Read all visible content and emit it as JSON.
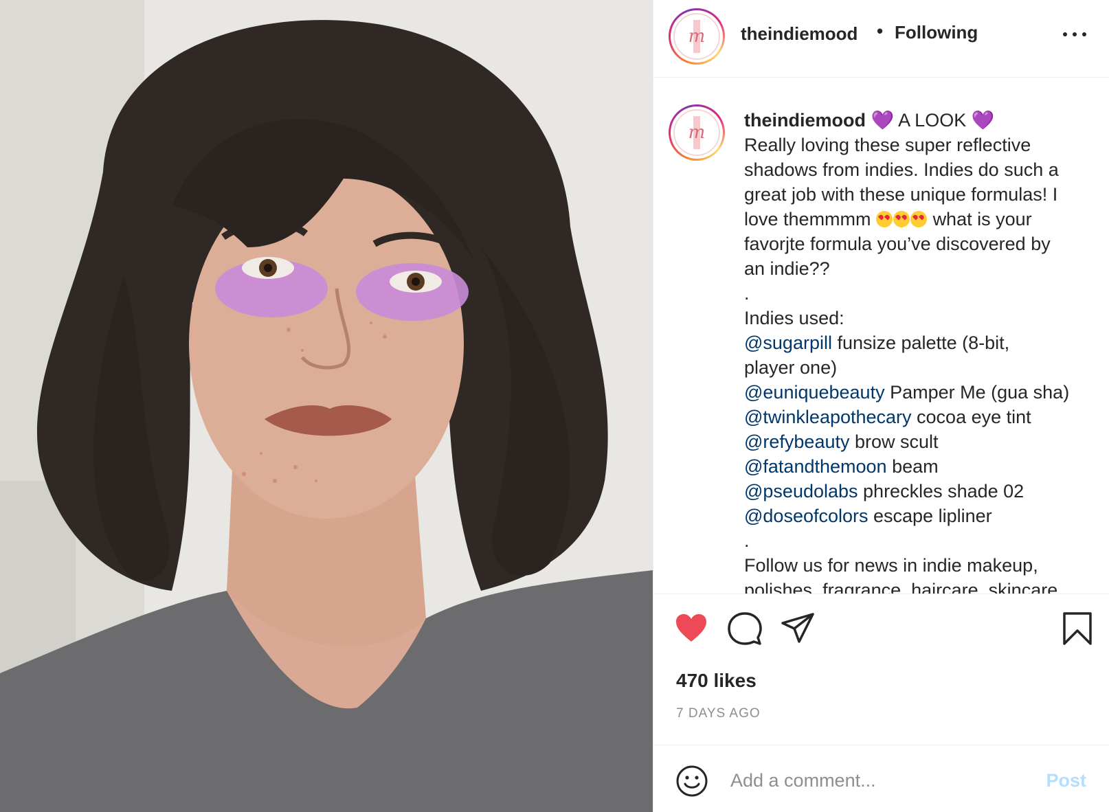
{
  "post": {
    "username": "theindiemood",
    "separator": "•",
    "follow_status": "Following",
    "more_icon": "more-horizontal-icon"
  },
  "caption": {
    "username": "theindiemood",
    "title": "A LOOK",
    "heart_emoji": "💜",
    "lines": [
      "Really loving these super reflective",
      "shadows from indies. Indies do such a",
      "great job with these unique formulas! I"
    ],
    "love_prefix": "love themmmm",
    "love_suffix": "what is your",
    "lines2": [
      "favorjte formula you’ve discovered by",
      "an indie??",
      ".",
      "Indies used:"
    ],
    "products": [
      {
        "mention": "@sugarpill",
        "text": " funsize palette (8-bit,"
      },
      {
        "mention": "",
        "text": "player one)"
      },
      {
        "mention": "@euniquebeauty",
        "text": " Pamper Me (gua sha)"
      },
      {
        "mention": "@twinkleapothecary",
        "text": " cocoa eye tint"
      },
      {
        "mention": "@refybeauty",
        "text": " brow scult"
      },
      {
        "mention": "@fatandthemoon",
        "text": " beam"
      },
      {
        "mention": "@pseudolabs",
        "text": " phreckles shade 02"
      },
      {
        "mention": "@doseofcolors",
        "text": " escape lipliner"
      }
    ],
    "after": [
      ".",
      "Follow us for news in indie makeup,",
      "polishes, fragrance, haircare, skincare"
    ]
  },
  "actions": {
    "like_icon": "heart-filled-icon",
    "comment_icon": "comment-icon",
    "share_icon": "share-icon",
    "save_icon": "bookmark-icon",
    "like_color": "#ed4956"
  },
  "likes": "470 likes",
  "time_ago": "7 DAYS AGO",
  "comment": {
    "placeholder": "Add a comment...",
    "post_label": "Post",
    "emoji_icon": "smiley-icon"
  }
}
